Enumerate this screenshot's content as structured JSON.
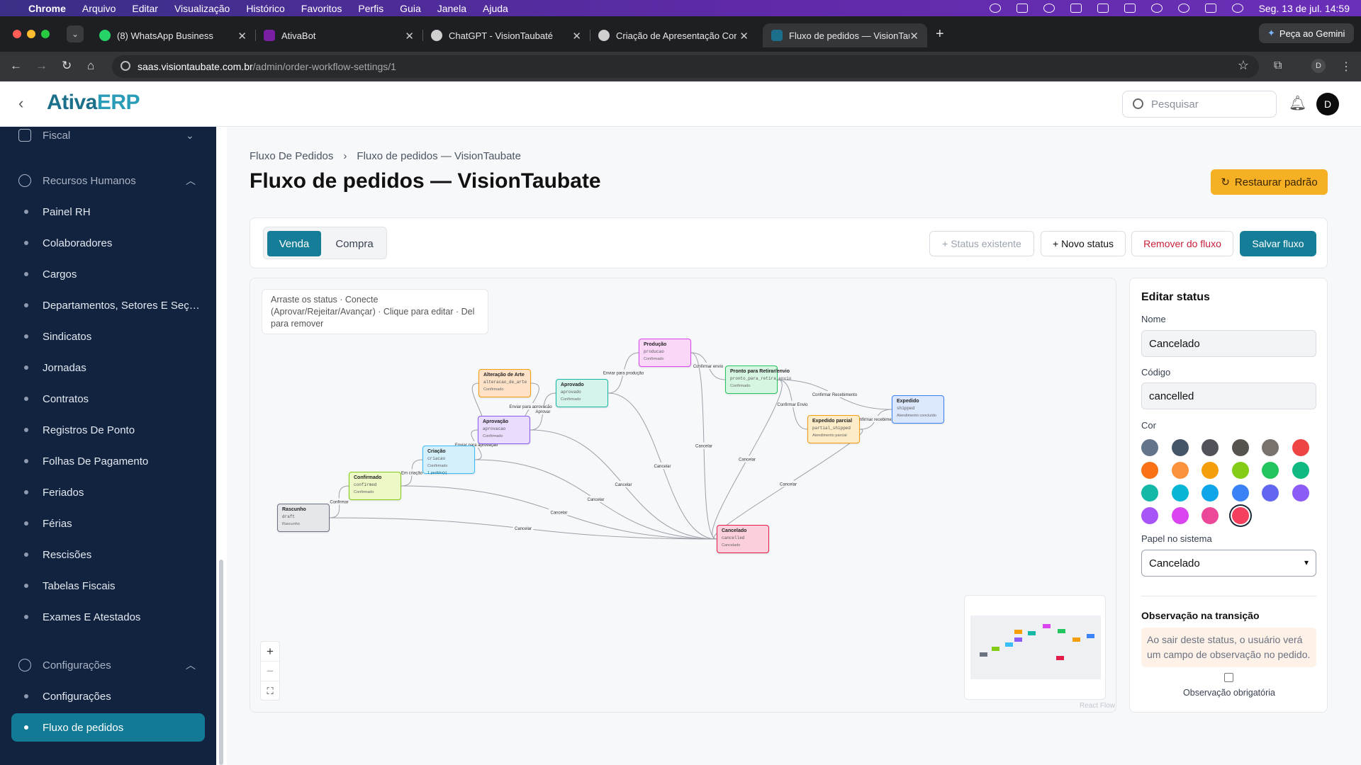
{
  "menubar": {
    "app": "Chrome",
    "items": [
      "Arquivo",
      "Editar",
      "Visualização",
      "Histórico",
      "Favoritos",
      "Perfis",
      "Guia",
      "Janela",
      "Ajuda"
    ],
    "datetime": "Seg. 13 de jul.  14:59"
  },
  "tabs": [
    {
      "label": "(8) WhatsApp Business",
      "fav_color": "#25d366"
    },
    {
      "label": "AtivaBot",
      "fav_color": "#7a1fa2"
    },
    {
      "label": "ChatGPT - VisionTaubaté",
      "fav_color": "#cfcfcf"
    },
    {
      "label": "Criação de Apresentação Cor",
      "fav_color": "#cfcfcf"
    },
    {
      "label": "Fluxo de pedidos — VisionTau",
      "fav_color": "#1c6f8a"
    }
  ],
  "gemini_label": "Peça ao Gemini",
  "address": {
    "host": "saas.visiontaubate.com.br",
    "path": "/admin/order-workflow-settings/1"
  },
  "profile_letter": "D",
  "logo": {
    "prefix": "Ativa",
    "suffix": "ERP"
  },
  "search": {
    "placeholder": "Pesquisar"
  },
  "user_initial": "D",
  "sidebar": {
    "top_section": "Fiscal",
    "hr_section": "Recursos Humanos",
    "hr_items": [
      "Painel RH",
      "Colaboradores",
      "Cargos",
      "Departamentos, Setores E Seções",
      "Sindicatos",
      "Jornadas",
      "Contratos",
      "Registros De Ponto",
      "Folhas De Pagamento",
      "Feriados",
      "Férias",
      "Rescisões",
      "Tabelas Fiscais",
      "Exames E Atestados"
    ],
    "config_section": "Configurações",
    "config_items": [
      "Configurações",
      "Fluxo de pedidos"
    ]
  },
  "breadcrumb": [
    "Fluxo De Pedidos",
    "Fluxo de pedidos — VisionTaubate"
  ],
  "page_title": "Fluxo de pedidos — VisionTaubate",
  "restore_label": "Restaurar padrão",
  "toolbar": {
    "venda": "Venda",
    "compra": "Compra",
    "existing": "+ Status existente",
    "new_status": "+ Novo status",
    "remove": "Remover do fluxo",
    "save": "Salvar fluxo"
  },
  "hint": "Arraste os status · Conecte (Aprovar/Rejeitar/Avançar) · Clique para editar · Del para remover",
  "nodes": [
    {
      "id": "draft",
      "name": "Rascunho",
      "code": "draft",
      "role": "Rascunho",
      "bg": "#e5e7eb",
      "border": "#6b7280"
    },
    {
      "id": "confirmed",
      "name": "Confirmado",
      "code": "confirmed",
      "role": "Confirmado",
      "bg": "#ecf9c6",
      "border": "#84cc16"
    },
    {
      "id": "criacao",
      "name": "Criação",
      "code": "criacao",
      "role": "Confirmado",
      "extra": "1 pedido(s)",
      "bg": "#d4f1fb",
      "border": "#38bdf8"
    },
    {
      "id": "aprovacao",
      "name": "Aprovação",
      "code": "aprovacao",
      "role": "Confirmado",
      "bg": "#e9dcfc",
      "border": "#8b5cf6"
    },
    {
      "id": "alteracao",
      "name": "Alteração de Arte",
      "code": "alteracao_de_arte",
      "role": "Confirmado",
      "bg": "#fde2c8",
      "border": "#f59e0b"
    },
    {
      "id": "aprovado",
      "name": "Aprovado",
      "code": "aprovado",
      "role": "Confirmado",
      "bg": "#d5f5ec",
      "border": "#14b8a6"
    },
    {
      "id": "producao",
      "name": "Produção",
      "code": "producao",
      "role": "Confirmado",
      "bg": "#fad7f6",
      "border": "#d946ef"
    },
    {
      "id": "pronto",
      "name": "Pronto para Retirar/envio",
      "code": "pronto_para_retira_envio",
      "role": "Confirmado",
      "bg": "#d6f6e1",
      "border": "#22c55e"
    },
    {
      "id": "parcial",
      "name": "Expedido parcial",
      "code": "partial_shipped",
      "role": "Atendimento parcial",
      "bg": "#fcecc8",
      "border": "#f59e0b"
    },
    {
      "id": "expedido",
      "name": "Expedido",
      "code": "shipped",
      "role": "Atendimento concluído",
      "bg": "#dbe7fd",
      "border": "#3b82f6"
    },
    {
      "id": "cancelado",
      "name": "Cancelado",
      "code": "cancelled",
      "role": "Cancelado",
      "bg": "#fbd0dc",
      "border": "#e11d48"
    }
  ],
  "edges": [
    {
      "from": "draft",
      "to": "confirmed",
      "label": "Confirmar"
    },
    {
      "from": "confirmed",
      "to": "criacao",
      "label": "Em criação"
    },
    {
      "from": "criacao",
      "to": "aprovacao",
      "label": "Enviar para aprovação"
    },
    {
      "from": "aprovacao",
      "to": "alteracao",
      "label": ""
    },
    {
      "from": "alteracao",
      "to": "aprovacao",
      "label": "Enviar para aprovação"
    },
    {
      "from": "aprovacao",
      "to": "aprovado",
      "label": "Aprovar"
    },
    {
      "from": "aprovado",
      "to": "producao",
      "label": "Enviar para produção"
    },
    {
      "from": "producao",
      "to": "pronto",
      "label": "Confirmar envio"
    },
    {
      "from": "pronto",
      "to": "expedido",
      "label": "Confirmar Recebimento"
    },
    {
      "from": "pronto",
      "to": "parcial",
      "label": "Confirmar Envio"
    },
    {
      "from": "parcial",
      "to": "expedido",
      "label": "Confirmar recebimento"
    },
    {
      "from": "draft",
      "to": "cancelado",
      "label": "Cancelar"
    },
    {
      "from": "confirmed",
      "to": "cancelado",
      "label": "Cancelar"
    },
    {
      "from": "criacao",
      "to": "cancelado",
      "label": "Cancelar"
    },
    {
      "from": "aprovacao",
      "to": "cancelado",
      "label": "Cancelar"
    },
    {
      "from": "aprovado",
      "to": "cancelado",
      "label": "Cancelar"
    },
    {
      "from": "producao",
      "to": "cancelado",
      "label": "Cancelar"
    },
    {
      "from": "pronto",
      "to": "cancelado",
      "label": "Cancelar"
    },
    {
      "from": "parcial",
      "to": "cancelado",
      "label": "Cancelar"
    }
  ],
  "zoom_controls": [
    "+",
    "−",
    "⛶"
  ],
  "attribution": "React Flow",
  "edit_panel": {
    "title": "Editar status",
    "name_label": "Nome",
    "name_value": "Cancelado",
    "code_label": "Código",
    "code_value": "cancelled",
    "color_label": "Cor",
    "colors": [
      "#64748b",
      "#475569",
      "#52525b",
      "#57534e",
      "#78716c",
      "#ef4444",
      "#f97316",
      "#fb923c",
      "#f59e0b",
      "#84cc16",
      "#22c55e",
      "#10b981",
      "#14b8a6",
      "#06b6d4",
      "#0ea5e9",
      "#3b82f6",
      "#6366f1",
      "#8b5cf6",
      "#a855f7",
      "#d946ef",
      "#ec4899",
      "#f43f5e"
    ],
    "selected_color": "#f43f5e",
    "role_label": "Papel no sistema",
    "role_value": "Cancelado",
    "note_title": "Observação na transição",
    "note_text": "Ao sair deste status, o usuário verá um campo de observação no pedido.",
    "required_label": "Observação obrigatória"
  }
}
